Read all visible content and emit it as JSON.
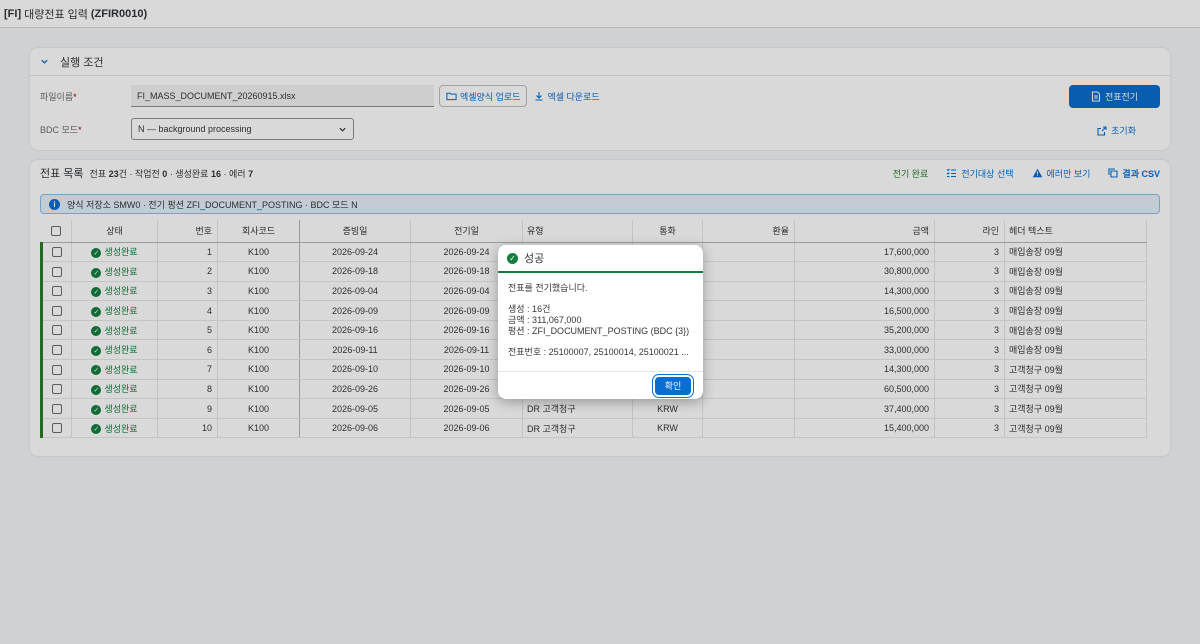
{
  "app": {
    "module": "[FI]",
    "title": "대량전표 입력",
    "tcode": "(ZFIR0010)"
  },
  "conditions": {
    "section_title": "실행 조건",
    "file_label": "파일이름",
    "file_value": "FI_MASS_DOCUMENT_20260915.xlsx",
    "upload_button": "엑셀양식 업로드",
    "download_button": "엑셀 다운로드",
    "bdc_label": "BDC 모드",
    "bdc_value": "N — background processing",
    "post_button": "전표전기",
    "reset_button": "초기화"
  },
  "list": {
    "title": "전표 목록",
    "meta": {
      "docs_label": "전표",
      "docs_count": "23",
      "docs_unit": "건 · 작업전",
      "pending": "0",
      "created_label": "· 생성완료",
      "created": "16",
      "error_label": "· 에러",
      "errors": "7"
    },
    "tools": {
      "posting_done": "전기 완료",
      "select_targets": "전기대상 선택",
      "errors_only": "에러만 보기",
      "result_csv": "결과 CSV"
    },
    "info": "양식 저장소 SMW0 · 전기 펑션 ZFI_DOCUMENT_POSTING · BDC 모드 N",
    "columns": {
      "status": "상태",
      "no": "번호",
      "company": "회사코드",
      "doc_date": "증빙일",
      "post_date": "전기일",
      "type": "유형",
      "currency": "통화",
      "rate": "환율",
      "amount": "금액",
      "lines": "라인",
      "header_text": "헤더 텍스트"
    },
    "rows": [
      {
        "status": "생성완료",
        "no": "1",
        "company": "K100",
        "doc_date": "2026-09-24",
        "post_date": "2026-09-24",
        "type": "",
        "currency": "",
        "rate": "",
        "amount": "17,600,000",
        "lines": "3",
        "header_text": "매입송장 09월"
      },
      {
        "status": "생성완료",
        "no": "2",
        "company": "K100",
        "doc_date": "2026-09-18",
        "post_date": "2026-09-18",
        "type": "",
        "currency": "",
        "rate": "",
        "amount": "30,800,000",
        "lines": "3",
        "header_text": "매입송장 09월"
      },
      {
        "status": "생성완료",
        "no": "3",
        "company": "K100",
        "doc_date": "2026-09-04",
        "post_date": "2026-09-04",
        "type": "",
        "currency": "",
        "rate": "",
        "amount": "14,300,000",
        "lines": "3",
        "header_text": "매입송장 09월"
      },
      {
        "status": "생성완료",
        "no": "4",
        "company": "K100",
        "doc_date": "2026-09-09",
        "post_date": "2026-09-09",
        "type": "",
        "currency": "",
        "rate": "",
        "amount": "16,500,000",
        "lines": "3",
        "header_text": "매입송장 09월"
      },
      {
        "status": "생성완료",
        "no": "5",
        "company": "K100",
        "doc_date": "2026-09-16",
        "post_date": "2026-09-16",
        "type": "",
        "currency": "",
        "rate": "",
        "amount": "35,200,000",
        "lines": "3",
        "header_text": "매입송장 09월"
      },
      {
        "status": "생성완료",
        "no": "6",
        "company": "K100",
        "doc_date": "2026-09-11",
        "post_date": "2026-09-11",
        "type": "",
        "currency": "",
        "rate": "",
        "amount": "33,000,000",
        "lines": "3",
        "header_text": "매입송장 09월"
      },
      {
        "status": "생성완료",
        "no": "7",
        "company": "K100",
        "doc_date": "2026-09-10",
        "post_date": "2026-09-10",
        "type": "",
        "currency": "",
        "rate": "",
        "amount": "14,300,000",
        "lines": "3",
        "header_text": "고객청구 09월"
      },
      {
        "status": "생성완료",
        "no": "8",
        "company": "K100",
        "doc_date": "2026-09-26",
        "post_date": "2026-09-26",
        "type": "",
        "currency": "",
        "rate": "",
        "amount": "60,500,000",
        "lines": "3",
        "header_text": "고객청구 09월"
      },
      {
        "status": "생성완료",
        "no": "9",
        "company": "K100",
        "doc_date": "2026-09-05",
        "post_date": "2026-09-05",
        "type": "DR 고객청구",
        "currency": "KRW",
        "rate": "",
        "amount": "37,400,000",
        "lines": "3",
        "header_text": "고객청구 09월"
      },
      {
        "status": "생성완료",
        "no": "10",
        "company": "K100",
        "doc_date": "2026-09-06",
        "post_date": "2026-09-06",
        "type": "DR 고객청구",
        "currency": "KRW",
        "rate": "",
        "amount": "15,400,000",
        "lines": "3",
        "header_text": "고객청구 09월"
      }
    ]
  },
  "dialog": {
    "title": "성공",
    "message": "전표를 전기했습니다.",
    "created": "생성 : 16건",
    "amount": "금액 : 311,067,000",
    "function": "펑션 : ZFI_DOCUMENT_POSTING (BDC {3})",
    "doc_numbers": "전표번호 : 25100007, 25100014, 25100021 ...",
    "ok_button": "확인"
  },
  "colors": {
    "accent": "#0a6ed1",
    "success": "#107e3e",
    "required": "#bb0000"
  }
}
